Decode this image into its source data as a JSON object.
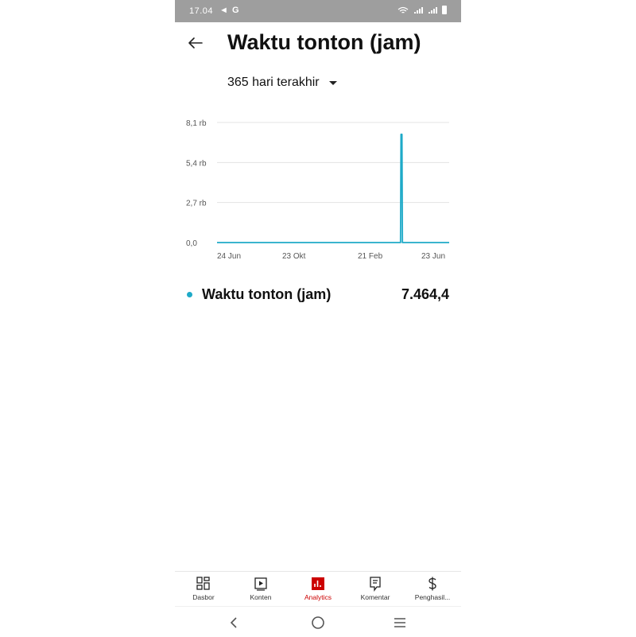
{
  "status_bar": {
    "time": "17.04",
    "nav_glyph": "◄",
    "g_label": "G"
  },
  "header": {
    "title": "Waktu tonton (jam)"
  },
  "filter": {
    "period": "365 hari terakhir"
  },
  "chart_data": {
    "type": "line",
    "title": "",
    "xlabel": "",
    "ylabel": "",
    "y_tick_labels": [
      "0,0",
      "2,7 rb",
      "5,4 rb",
      "8,1 rb"
    ],
    "y_ticks": [
      0,
      2700,
      5400,
      8100
    ],
    "ylim": [
      0,
      8100
    ],
    "x_tick_labels": [
      "24 Jun",
      "23 Okt",
      "21 Feb",
      "23 Jun"
    ],
    "x": [
      "24 Jun",
      "23 Okt",
      "21 Feb",
      "23 Jun"
    ],
    "series": [
      {
        "values": [
          0,
          0,
          0,
          0
        ],
        "spike": {
          "label": "approx. early Apr",
          "value": 7300
        }
      }
    ],
    "line_color": "#1eaac8",
    "grid": true
  },
  "legend": {
    "name": "Waktu tonton (jam)",
    "value": "7.464,4"
  },
  "bottom_nav": [
    {
      "label": "Dasbor",
      "icon": "dashboard-icon",
      "active": false
    },
    {
      "label": "Konten",
      "icon": "content-icon",
      "active": false
    },
    {
      "label": "Analytics",
      "icon": "analytics-icon",
      "active": true
    },
    {
      "label": "Komentar",
      "icon": "comments-icon",
      "active": false
    },
    {
      "label": "Penghasil...",
      "icon": "earn-icon",
      "active": false
    }
  ],
  "colors": {
    "accent": "#cc0000",
    "series": "#1eaac8",
    "status_bar": "#9e9e9e"
  }
}
